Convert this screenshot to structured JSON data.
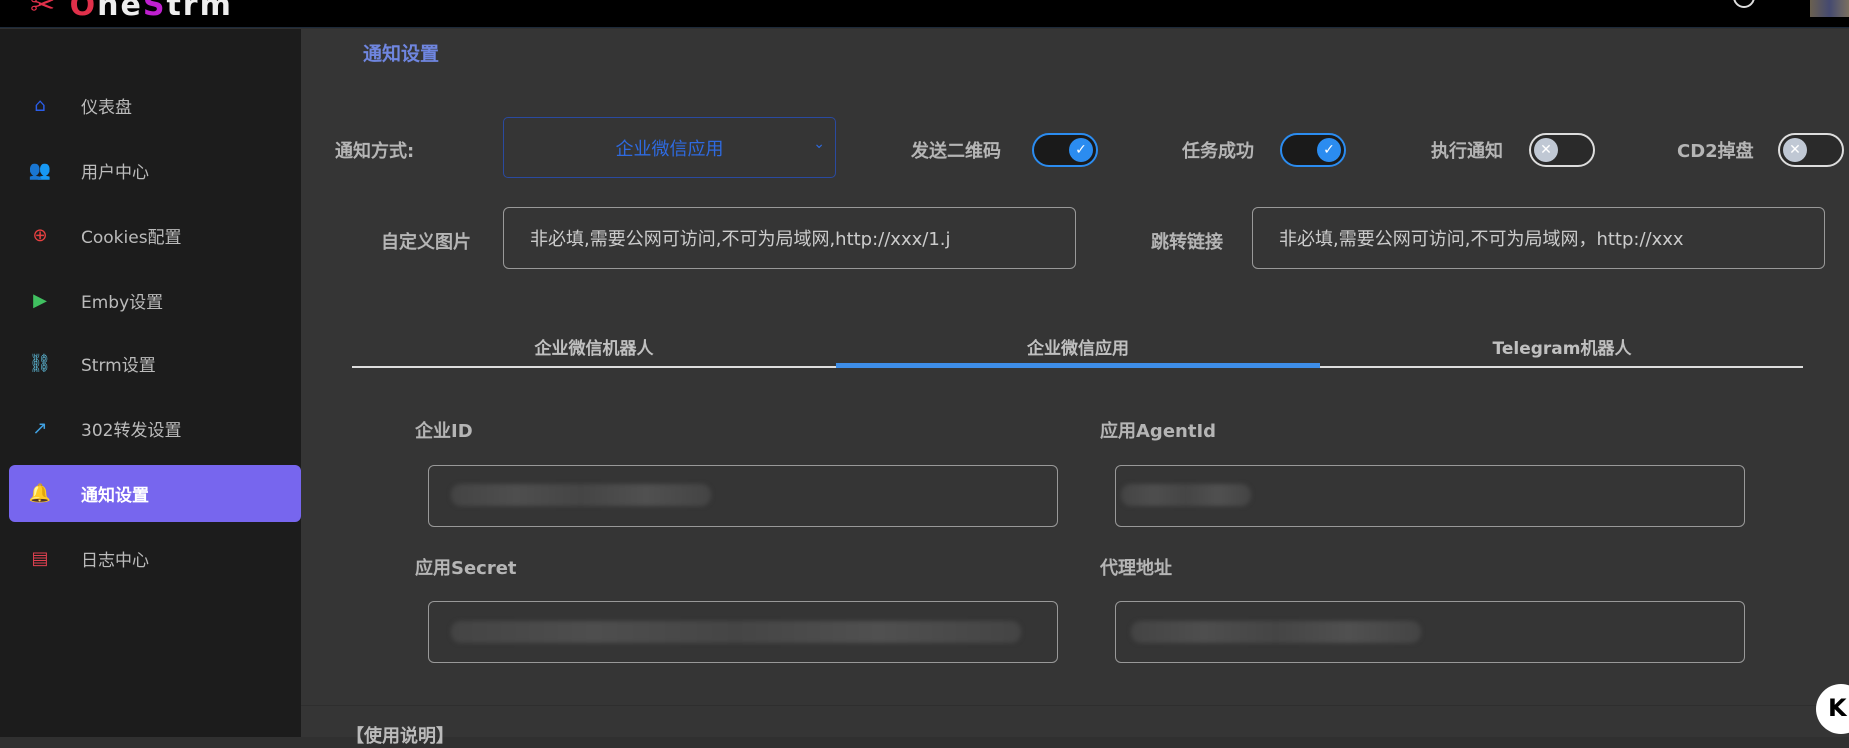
{
  "header": {
    "logo_text": "OneStrm"
  },
  "sidebar": {
    "items": [
      {
        "label": "仪表盘",
        "icon": "home-icon",
        "color": "#2a5de8"
      },
      {
        "label": "用户中心",
        "icon": "users-icon",
        "color": "#f0a040"
      },
      {
        "label": "Cookies配置",
        "icon": "plus-circle-icon",
        "color": "#e84040"
      },
      {
        "label": "Emby设置",
        "icon": "play-icon",
        "color": "#40c060"
      },
      {
        "label": "Strm设置",
        "icon": "link-icon",
        "color": "#60c0e0"
      },
      {
        "label": "302转发设置",
        "icon": "external-link-icon",
        "color": "#40a0e0"
      },
      {
        "label": "通知设置",
        "icon": "bell-icon",
        "color": "#ffffff"
      },
      {
        "label": "日志中心",
        "icon": "file-icon",
        "color": "#e04050"
      }
    ]
  },
  "main": {
    "title": "通知设置",
    "method_label": "通知方式:",
    "method_value": "企业微信应用",
    "toggles": [
      {
        "label": "发送二维码",
        "on": true
      },
      {
        "label": "任务成功",
        "on": true
      },
      {
        "label": "执行通知",
        "on": false
      },
      {
        "label": "CD2掉盘",
        "on": false
      }
    ],
    "custom_image_label": "自定义图片",
    "custom_image_placeholder": "非必填,需要公网可访问,不可为局域网,http://xxx/1.j",
    "jump_link_label": "跳转链接",
    "jump_link_placeholder": "非必填,需要公网可访问,不可为局域网，http://xxx",
    "tabs": [
      "企业微信机器人",
      "企业微信应用",
      "Telegram机器人"
    ],
    "active_tab": 1,
    "fields": {
      "corp_id": "企业ID",
      "agent_id": "应用AgentId",
      "secret": "应用Secret",
      "proxy": "代理地址"
    },
    "usage": "【使用说明】"
  }
}
